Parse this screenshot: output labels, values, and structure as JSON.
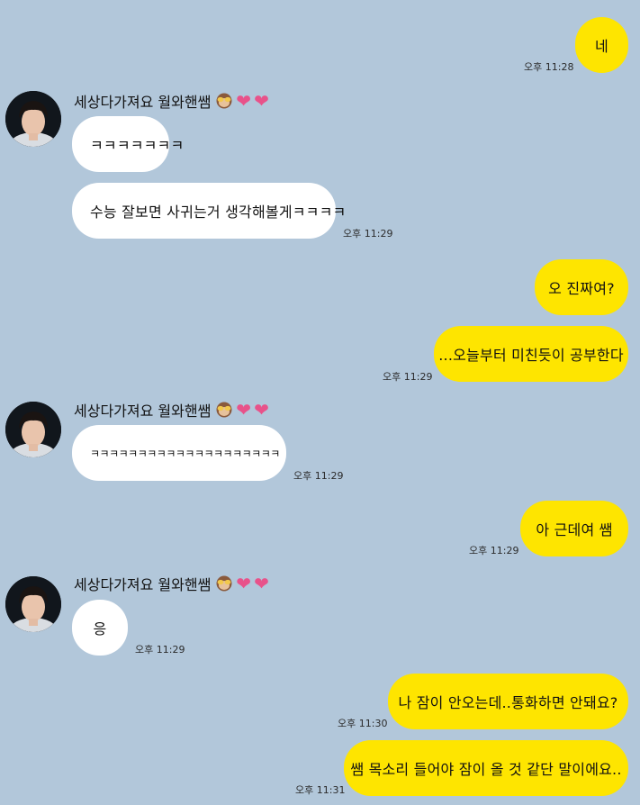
{
  "contact": {
    "name": "세상다가져요 월와핸쌤",
    "name_emojis": [
      "see-no-evil-monkey",
      "heart",
      "heart"
    ],
    "bubble_colors": {
      "sent": "#fee500",
      "received": "#ffffff",
      "background": "#b2c7da",
      "heart": "#e8528a"
    }
  },
  "messages": [
    {
      "side": "sent",
      "text": "네",
      "time": "오후 11:28"
    },
    {
      "side": "received",
      "text": "ㅋㅋㅋㅋㅋㅋㅋ",
      "time": ""
    },
    {
      "side": "received",
      "text": "수능 잘보면 사귀는거 생각해볼게ㅋㅋㅋㅋ",
      "time": "오후 11:29"
    },
    {
      "side": "sent",
      "text": "오 진짜여?",
      "time": ""
    },
    {
      "side": "sent",
      "text": "...오늘부터 미친듯이 공부한다",
      "time": "오후 11:29"
    },
    {
      "side": "received",
      "text": "ㅋㅋㅋㅋㅋㅋㅋㅋㅋㅋㅋㅋㅋㅋㅋㅋㅋㅋㅋㅋ",
      "time": "오후 11:29"
    },
    {
      "side": "sent",
      "text": "아 근데여 쌤",
      "time": "오후 11:29"
    },
    {
      "side": "received",
      "text": "응",
      "time": "오후 11:29"
    },
    {
      "side": "sent",
      "text": "나 잠이 안오는데..통화하면 안돼요?",
      "time": "오후 11:30"
    },
    {
      "side": "sent",
      "text": "쌤 목소리 들어야 잠이 올 것 같단 말이에요..",
      "time": "오후 11:31"
    }
  ]
}
